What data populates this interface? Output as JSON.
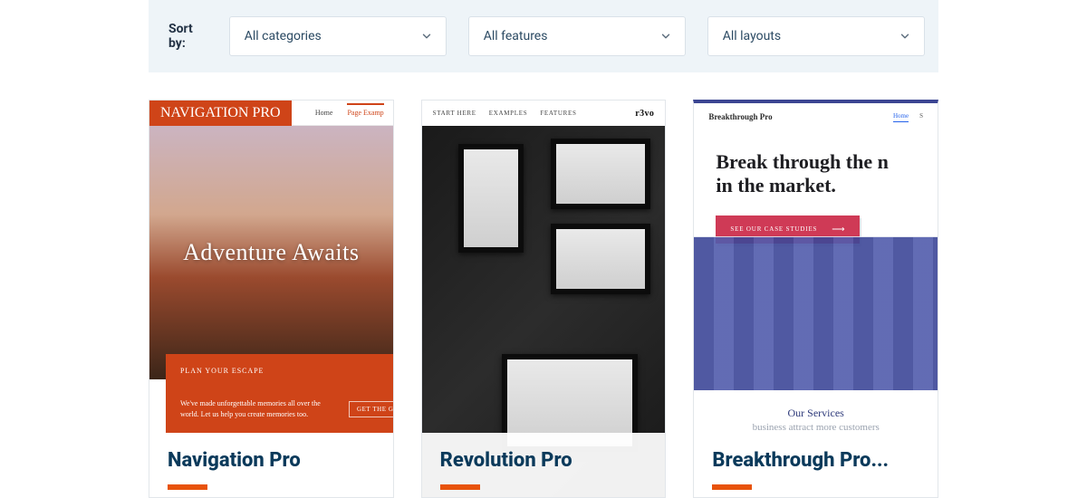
{
  "filters": {
    "label": "Sort by:",
    "categories": {
      "value": "All categories"
    },
    "features": {
      "value": "All features"
    },
    "layouts": {
      "value": "All layouts"
    }
  },
  "cards": [
    {
      "title": "Navigation Pro",
      "preview": {
        "brand": "NAVIGATION PRO",
        "menu_home": "Home",
        "menu_page": "Page Examp",
        "hero_text": "Adventure Awaits",
        "panel_heading": "PLAN YOUR ESCAPE",
        "panel_copy": "We've made unforgettable memories all over the world. Let us help you create memories too.",
        "panel_button": "GET THE GUID"
      }
    },
    {
      "title": "Revolution Pro",
      "preview": {
        "menu_start": "START HERE",
        "menu_examples": "EXAMPLES",
        "menu_features": "FEATURES",
        "logo": "r3vo"
      }
    },
    {
      "title": "Breakthrough Pro...",
      "preview": {
        "brand": "Breakthrough Pro",
        "menu_home": "Home",
        "menu_s": "S",
        "headline": "Break through the n\nin the market.",
        "cta": "SEE OUR CASE STUDIES",
        "footer_heading": "Our Services",
        "footer_copy": "business attract more customers"
      }
    }
  ]
}
